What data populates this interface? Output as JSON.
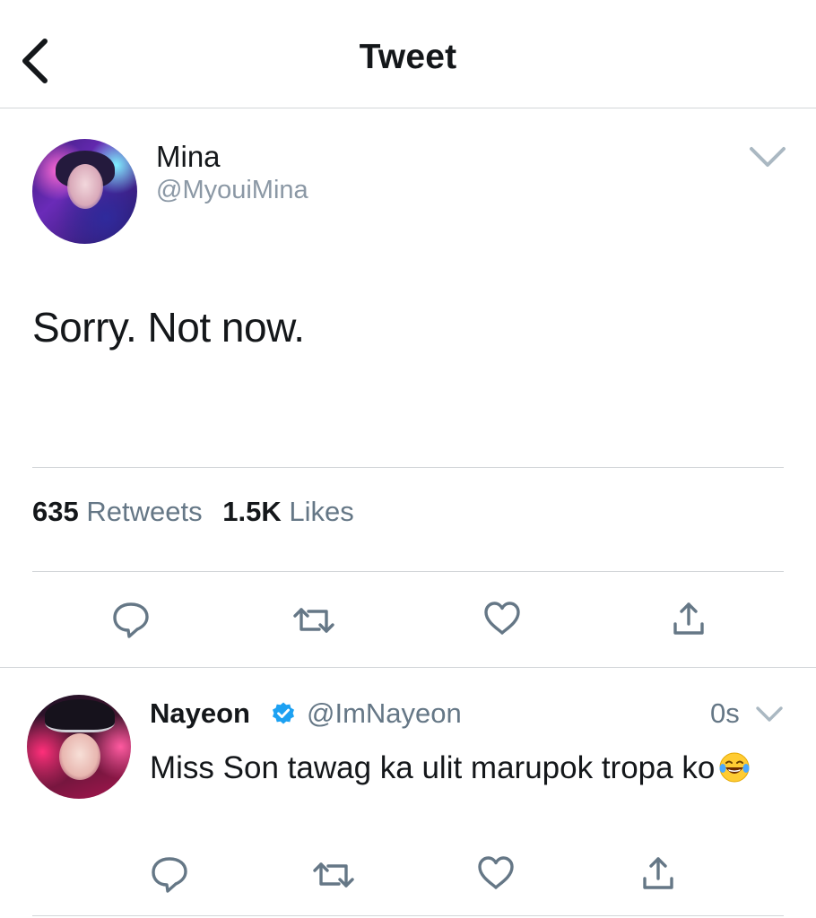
{
  "header": {
    "title": "Tweet"
  },
  "main_tweet": {
    "display_name": "Mina",
    "handle": "@MyouiMina",
    "text": "Sorry. Not now.",
    "stats": {
      "retweets_count": "635",
      "retweets_label": "Retweets",
      "likes_count": "1.5K",
      "likes_label": "Likes"
    }
  },
  "reply": {
    "display_name": "Nayeon",
    "handle": "@ImNayeon",
    "time": "0s",
    "text": "Miss Son tawag ka ulit marupok tropa ko",
    "emoji": "face-with-tears-of-joy"
  },
  "icons": {
    "back": "chevron-left-icon",
    "caret": "chevron-down-icon",
    "reply": "reply-icon",
    "retweet": "retweet-icon",
    "like": "heart-icon",
    "share": "share-icon",
    "verified": "verified-badge-icon"
  },
  "colors": {
    "text": "#14171a",
    "secondary": "#657786",
    "handle": "#8b98a5",
    "icon": "#657786",
    "verified": "#1da1f2",
    "divider": "#d3d6d9"
  }
}
